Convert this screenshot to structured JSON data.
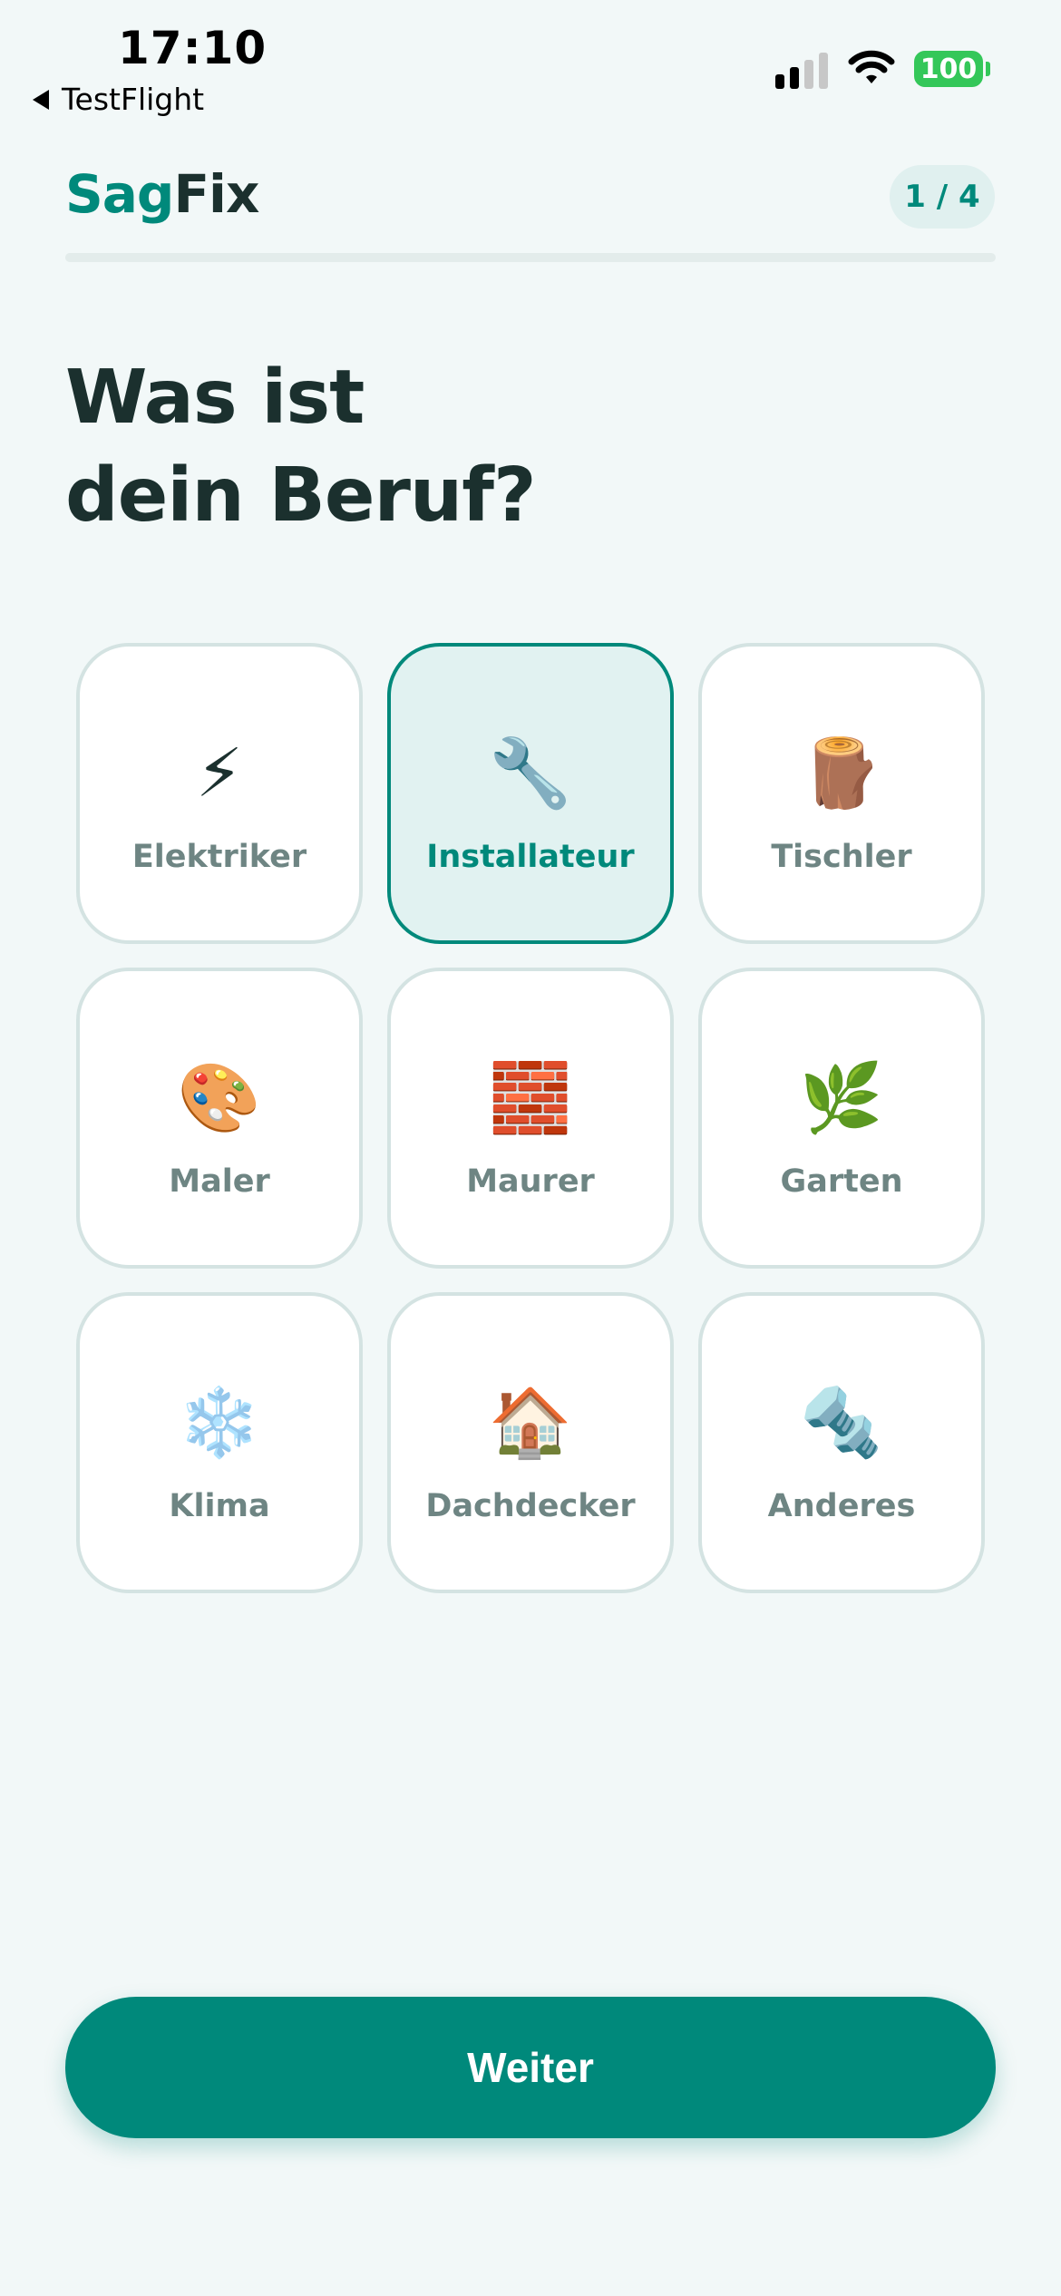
{
  "status_bar": {
    "time": "17:10",
    "back_label": "TestFlight",
    "battery": "100"
  },
  "header": {
    "brand_part1": "Sag",
    "brand_part2": "Fix",
    "step": "1 / 4",
    "progress_fraction": 0.25
  },
  "question": {
    "line1": "Was ist",
    "line2": "dein Beruf?"
  },
  "professions": [
    {
      "label": "Elektriker",
      "icon": "⚡",
      "icon_name": "lightning-icon",
      "selected": false
    },
    {
      "label": "Installateur",
      "icon": "🔧",
      "icon_name": "wrench-icon",
      "selected": true
    },
    {
      "label": "Tischler",
      "icon": "🪵",
      "icon_name": "wood-icon",
      "selected": false
    },
    {
      "label": "Maler",
      "icon": "🎨",
      "icon_name": "palette-icon",
      "selected": false
    },
    {
      "label": "Maurer",
      "icon": "🧱",
      "icon_name": "brick-icon",
      "selected": false
    },
    {
      "label": "Garten",
      "icon": "🌿",
      "icon_name": "herb-icon",
      "selected": false
    },
    {
      "label": "Klima",
      "icon": "❄️",
      "icon_name": "snowflake-icon",
      "selected": false
    },
    {
      "label": "Dachdecker",
      "icon": "🏠",
      "icon_name": "house-icon",
      "selected": false
    },
    {
      "label": "Anderes",
      "icon": "🔩",
      "icon_name": "nut-bolt-icon",
      "selected": false
    }
  ],
  "continue_label": "Weiter",
  "colors": {
    "accent": "#00897B",
    "background": "#F2F8F8",
    "selected_card": "#E1F2F1",
    "card_border": "#D4E3E2"
  }
}
